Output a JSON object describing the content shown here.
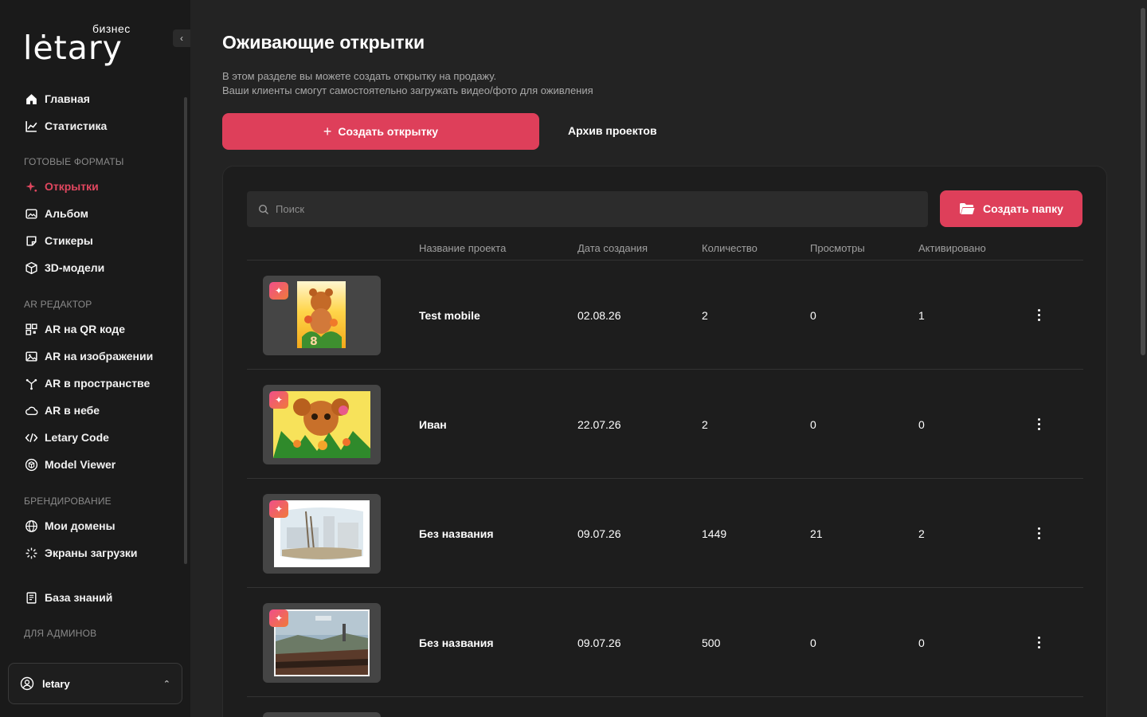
{
  "brand": {
    "logo_text": "lėtary",
    "logo_sub": "бизнес"
  },
  "sidebar": {
    "items": [
      {
        "label": "Главная",
        "icon": "home-icon"
      },
      {
        "label": "Статистика",
        "icon": "chart-icon"
      }
    ],
    "sections": [
      {
        "title": "ГОТОВЫЕ ФОРМАТЫ",
        "items": [
          {
            "label": "Открытки",
            "icon": "sparkle-icon",
            "active": true
          },
          {
            "label": "Альбом",
            "icon": "album-icon"
          },
          {
            "label": "Стикеры",
            "icon": "sticker-icon"
          },
          {
            "label": "3D-модели",
            "icon": "cube-icon"
          }
        ]
      },
      {
        "title": "AR РЕДАКТОР",
        "items": [
          {
            "label": "AR на QR коде",
            "icon": "qr-icon"
          },
          {
            "label": "AR на изображении",
            "icon": "image-icon"
          },
          {
            "label": "AR в пространстве",
            "icon": "space-icon"
          },
          {
            "label": "AR в небе",
            "icon": "cloud-icon"
          },
          {
            "label": "Letary Code",
            "icon": "code-icon"
          },
          {
            "label": "Model Viewer",
            "icon": "model-viewer-icon"
          }
        ]
      },
      {
        "title": "БРЕНДИРОВАНИЕ",
        "items": [
          {
            "label": "Мои домены",
            "icon": "globe-icon"
          },
          {
            "label": "Экраны загрузки",
            "icon": "loader-icon"
          }
        ]
      }
    ],
    "knowledge": {
      "label": "База знаний",
      "icon": "book-icon"
    },
    "admin_section": "ДЛЯ АДМИНОВ",
    "user": {
      "name": "letary"
    }
  },
  "main": {
    "title": "Оживающие открытки",
    "desc_line1": "В этом разделе вы можете создать открытку на продажу.",
    "desc_line2": "Ваши клиенты смогут самостоятельно загружать видео/фото для оживления",
    "create_label": "Создать открытку",
    "archive_label": "Архив проектов"
  },
  "panel": {
    "search_placeholder": "Поиск",
    "folder_label": "Создать папку",
    "columns": [
      "Название проекта",
      "Дата создания",
      "Количество",
      "Просмотры",
      "Активировано"
    ],
    "rows": [
      {
        "name": "Test mobile",
        "date": "02.08.26",
        "count": "2",
        "views": "0",
        "activated": "1"
      },
      {
        "name": "Иван",
        "date": "22.07.26",
        "count": "2",
        "views": "0",
        "activated": "0"
      },
      {
        "name": "Без названия",
        "date": "09.07.26",
        "count": "1449",
        "views": "21",
        "activated": "2"
      },
      {
        "name": "Без названия",
        "date": "09.07.26",
        "count": "500",
        "views": "0",
        "activated": "0"
      }
    ]
  },
  "colors": {
    "accent": "#de3f5a",
    "bg": "#232323",
    "sidebar": "#1a1a1a"
  }
}
